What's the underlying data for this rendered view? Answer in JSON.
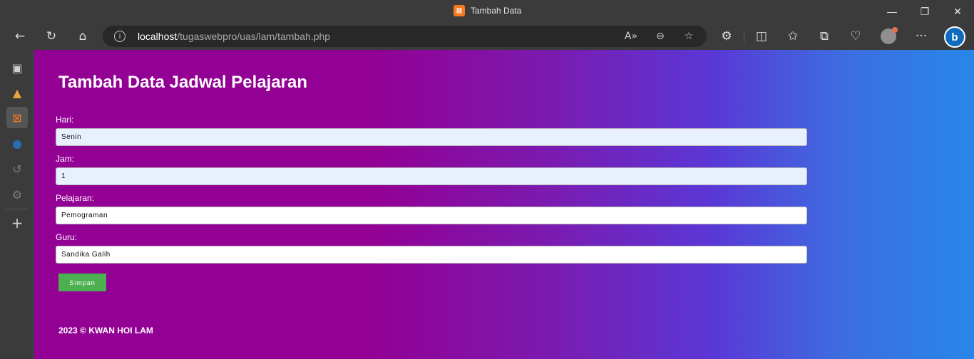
{
  "window": {
    "title": "Tambah Data",
    "minimize": "—",
    "maximize": "❐",
    "close": "✕"
  },
  "toolbar": {
    "back_icon": "←",
    "refresh_icon": "↻",
    "home_icon": "⌂",
    "url_host": "localhost",
    "url_path": "/tugaswebpro/uas/lam/tambah.php",
    "read_aloud_icon": "A»",
    "zoom_icon": "⊖",
    "favorite_icon": "☆",
    "extensions_icon": "⚙",
    "split_icon": "◫",
    "favorites_icon": "✩",
    "collections_icon": "⧉",
    "health_icon": "♡",
    "more_icon": "···",
    "bing_label": "b"
  },
  "sidebar": {
    "tabs_icon": "▣",
    "app1_icon": "▲",
    "app2_icon": "⊠",
    "app3_icon": "●",
    "history_icon": "↺",
    "settings_icon": "⚙",
    "add_icon": "+"
  },
  "page": {
    "heading": "Tambah Data Jadwal Pelajaran",
    "fields": [
      {
        "label": "Hari:",
        "value": "Senin"
      },
      {
        "label": "Jam:",
        "value": "1"
      },
      {
        "label": "Pelajaran:",
        "value": "Pemograman"
      },
      {
        "label": "Guru:",
        "value": "Sandika Galih"
      }
    ],
    "submit_label": "Simpan",
    "footer": "2023 © KWAN HOI LAM"
  },
  "colors": {
    "gradient_start": "#930094",
    "gradient_end": "#2886ea",
    "button": "#4caf50",
    "autofill": "#e8f0fe"
  }
}
